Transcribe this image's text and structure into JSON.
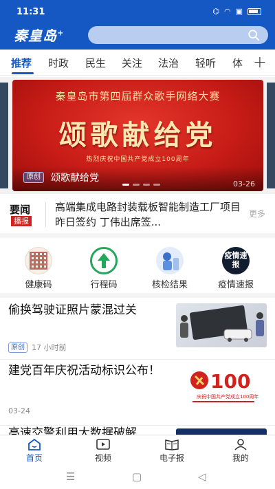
{
  "status": {
    "time": "11:31"
  },
  "header": {
    "logo": "秦皇岛",
    "logo_plus": "+"
  },
  "tabs": [
    {
      "label": "推荐",
      "active": true
    },
    {
      "label": "时政"
    },
    {
      "label": "民生"
    },
    {
      "label": "关注"
    },
    {
      "label": "法治"
    },
    {
      "label": "轻听"
    },
    {
      "label": "体"
    }
  ],
  "banner": {
    "headline": "秦皇岛市第四届群众歌手网络大赛",
    "big_text": "颂歌献给党",
    "sub_text": "热烈庆祝中国共产党成立100周年",
    "badge": "原创",
    "caption": "颂歌献给党",
    "date": "03-26"
  },
  "yaowen": {
    "label": "要闻",
    "tag": "播报",
    "text": "高端集成电路封装载板智能制造工厂项目昨日签约 丁伟出席签...",
    "more": "更多"
  },
  "quick": [
    {
      "label": "健康码",
      "icon": "health-qr-icon"
    },
    {
      "label": "行程码",
      "icon": "trip-arrow-icon"
    },
    {
      "label": "核检结果",
      "icon": "nucleic-test-icon"
    },
    {
      "label": "疫情速报",
      "icon": "epidemic-report-icon",
      "icon_text": "疫情速报"
    }
  ],
  "news": [
    {
      "title": "偷换驾驶证照片蒙混过关",
      "badge": "原创",
      "time": "17 小时前"
    },
    {
      "title": "建党百年庆祝活动标识公布！",
      "time": "03-24",
      "thumb_text": "100",
      "thumb_caption": "庆祝中国共产党成立100周年"
    },
    {
      "title": "高速交警利用大数据破解"
    }
  ],
  "bottom_nav": [
    {
      "label": "首页",
      "active": true
    },
    {
      "label": "视频"
    },
    {
      "label": "电子报"
    },
    {
      "label": "我的"
    }
  ],
  "colors": {
    "brand": "#1558c4",
    "banner_red": "#c81c17",
    "tag_red": "#d1231d"
  }
}
